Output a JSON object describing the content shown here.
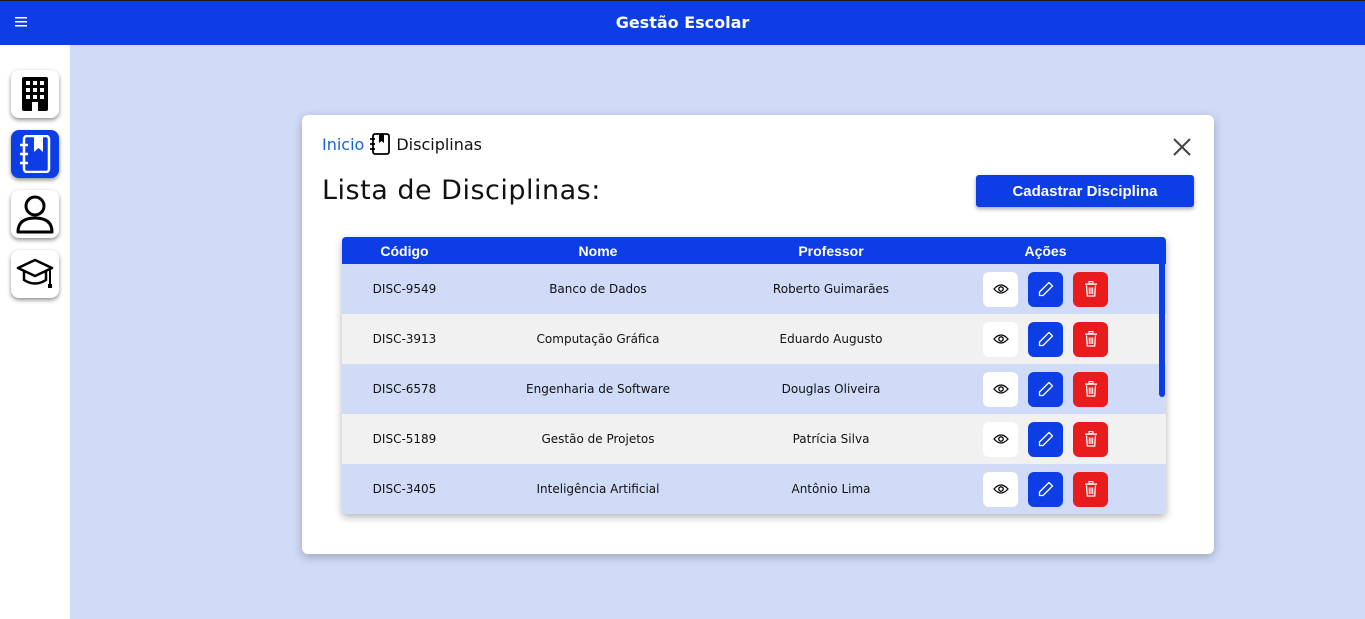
{
  "app": {
    "title": "Gestão Escolar"
  },
  "icons": {
    "menu": "hamburger-icon",
    "sidebar": [
      "building-icon",
      "notebook-icon",
      "user-icon",
      "graduation-cap-icon"
    ],
    "breadcrumb": "notebook-icon",
    "close": "close-icon",
    "actions": [
      "eye-icon",
      "pencil-icon",
      "trash-icon"
    ]
  },
  "colors": {
    "primary": "#0d3ee5",
    "danger": "#e81c1c",
    "background": "#d0dbf7"
  },
  "breadcrumb": {
    "home": "Inicio",
    "current": "Disciplinas"
  },
  "page": {
    "title": "Lista de Disciplinas:",
    "add_button": "Cadastrar Disciplina"
  },
  "table": {
    "headers": [
      "Código",
      "Nome",
      "Professor",
      "Ações"
    ],
    "rows": [
      {
        "codigo": "DISC-9549",
        "nome": "Banco de Dados",
        "professor": "Roberto Guimarães"
      },
      {
        "codigo": "DISC-3913",
        "nome": "Computação Gráfica",
        "professor": "Eduardo Augusto"
      },
      {
        "codigo": "DISC-6578",
        "nome": "Engenharia de Software",
        "professor": "Douglas Oliveira"
      },
      {
        "codigo": "DISC-5189",
        "nome": "Gestão de Projetos",
        "professor": "Patrícia Silva"
      },
      {
        "codigo": "DISC-3405",
        "nome": "Inteligência Artificial",
        "professor": "Antônio Lima"
      }
    ]
  }
}
